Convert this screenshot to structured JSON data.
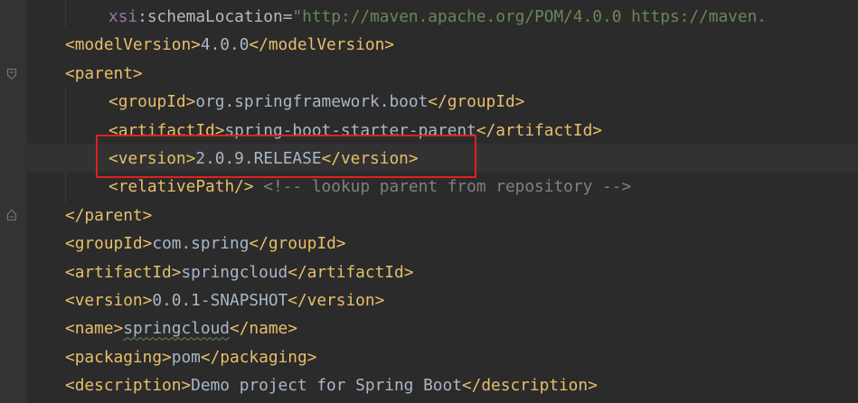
{
  "editor": {
    "lines": [
      {
        "indent": 1,
        "parts": [
          {
            "t": "attr-ns",
            "v": "xsi"
          },
          {
            "t": "attr",
            "v": ":schemaLocation"
          },
          {
            "t": "txt",
            "v": "="
          },
          {
            "t": "str",
            "v": "\"http://maven.apache.org/POM/4.0.0 https://maven."
          }
        ]
      },
      {
        "indent": 0,
        "parts": [
          {
            "t": "tag",
            "v": "<modelVersion>"
          },
          {
            "t": "txt",
            "v": "4.0.0"
          },
          {
            "t": "tag",
            "v": "</modelVersion>"
          }
        ]
      },
      {
        "indent": 0,
        "parts": [
          {
            "t": "tag",
            "v": "<parent>"
          }
        ]
      },
      {
        "indent": 1,
        "parts": [
          {
            "t": "tag",
            "v": "<groupId>"
          },
          {
            "t": "txt",
            "v": "org.springframework.boot"
          },
          {
            "t": "tag",
            "v": "</groupId>"
          }
        ]
      },
      {
        "indent": 1,
        "parts": [
          {
            "t": "tag",
            "v": "<artifactId>"
          },
          {
            "t": "txt",
            "v": "spring-boot-starter-parent"
          },
          {
            "t": "tag",
            "v": "</artifactId>"
          }
        ]
      },
      {
        "indent": 1,
        "parts": [
          {
            "t": "tag",
            "v": "<version>"
          },
          {
            "t": "txt",
            "v": "2.0.9.RELEASE"
          },
          {
            "t": "tag",
            "v": "</version>"
          }
        ]
      },
      {
        "indent": 1,
        "parts": [
          {
            "t": "tag",
            "v": "<relativePath/>"
          },
          {
            "t": "txt",
            "v": " "
          },
          {
            "t": "cmt",
            "v": "<!-- lookup parent from repository -->"
          }
        ]
      },
      {
        "indent": 0,
        "parts": [
          {
            "t": "tag",
            "v": "</parent>"
          }
        ]
      },
      {
        "indent": 0,
        "parts": [
          {
            "t": "tag",
            "v": "<groupId>"
          },
          {
            "t": "txt",
            "v": "com.spring"
          },
          {
            "t": "tag",
            "v": "</groupId>"
          }
        ]
      },
      {
        "indent": 0,
        "parts": [
          {
            "t": "tag",
            "v": "<artifactId>"
          },
          {
            "t": "txt",
            "v": "springcloud"
          },
          {
            "t": "tag",
            "v": "</artifactId>"
          }
        ]
      },
      {
        "indent": 0,
        "parts": [
          {
            "t": "tag",
            "v": "<version>"
          },
          {
            "t": "txt",
            "v": "0.0.1-SNAPSHOT"
          },
          {
            "t": "tag",
            "v": "</version>"
          }
        ]
      },
      {
        "indent": 0,
        "parts": [
          {
            "t": "tag",
            "v": "<name>"
          },
          {
            "t": "txt typo",
            "v": "springcloud"
          },
          {
            "t": "tag",
            "v": "</name>"
          }
        ]
      },
      {
        "indent": 0,
        "parts": [
          {
            "t": "tag",
            "v": "<packaging>"
          },
          {
            "t": "txt",
            "v": "pom"
          },
          {
            "t": "tag",
            "v": "</packaging>"
          }
        ]
      },
      {
        "indent": 0,
        "parts": [
          {
            "t": "tag",
            "v": "<description>"
          },
          {
            "t": "txt",
            "v": "Demo project for Spring Boot"
          },
          {
            "t": "tag",
            "v": "</description>"
          }
        ]
      }
    ]
  },
  "colors": {
    "background": "#2b2b2b",
    "gutter": "#313335",
    "tag": "#e8bf6a",
    "text": "#a9b7c6",
    "string": "#6a8759",
    "comment": "#808080",
    "namespace": "#9876aa",
    "highlight": "#e02020"
  },
  "icons": [
    "fold-open-icon",
    "fold-close-icon"
  ]
}
